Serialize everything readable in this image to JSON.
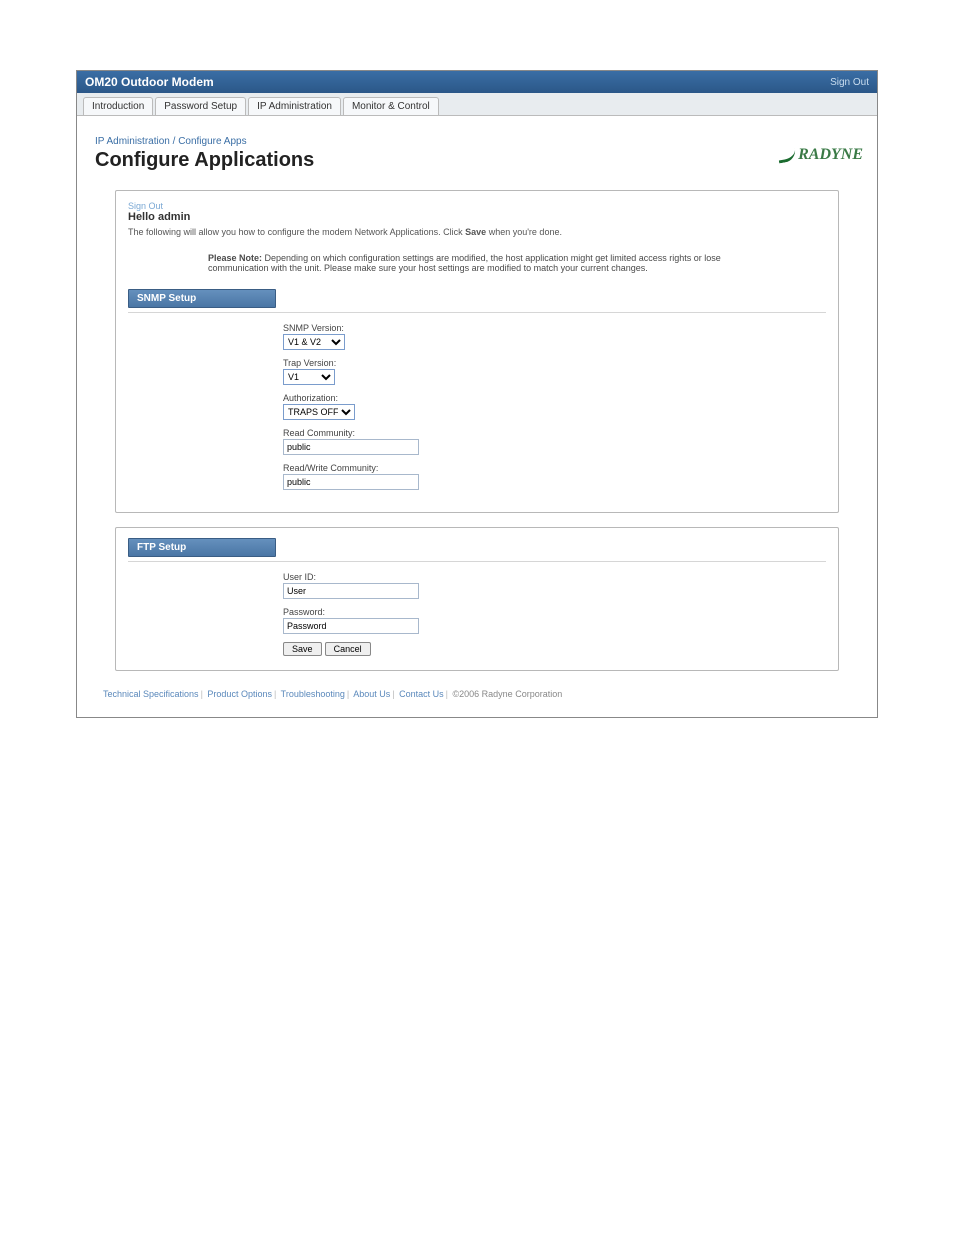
{
  "title_bar": {
    "product": "OM20 Outdoor Modem",
    "signout": "Sign Out"
  },
  "tabs": [
    "Introduction",
    "Password Setup",
    "IP Administration",
    "Monitor & Control"
  ],
  "breadcrumb": "IP Administration / Configure Apps",
  "page_title": "Configure Applications",
  "logo_text": "RADYNE",
  "greeting": {
    "signout": "Sign Out",
    "hello": "Hello admin",
    "desc_pre": "The following will allow you how to configure the modem Network Applications. Click ",
    "desc_bold": "Save",
    "desc_post": " when you're done.",
    "note_bold": "Please Note:",
    "note_rest": " Depending on which configuration settings are modified, the host application might get limited access rights or lose communication with the unit. Please make sure your host settings are modified to match your current changes."
  },
  "snmp": {
    "title": "SNMP Setup",
    "fields": {
      "snmp_version": {
        "label": "SNMP Version:",
        "value": "V1 & V2"
      },
      "trap_version": {
        "label": "Trap Version:",
        "value": "V1"
      },
      "authorization": {
        "label": "Authorization:",
        "value": "TRAPS OFF"
      },
      "read_comm": {
        "label": "Read Community:",
        "value": "public"
      },
      "rw_comm": {
        "label": "Read/Write Community:",
        "value": "public"
      }
    }
  },
  "ftp": {
    "title": "FTP Setup",
    "fields": {
      "user": {
        "label": "User ID:",
        "value": "User"
      },
      "password": {
        "label": "Password:",
        "value": "Password"
      }
    }
  },
  "buttons": {
    "save": "Save",
    "cancel": "Cancel"
  },
  "footer": {
    "links": [
      "Technical Specifications",
      "Product Options",
      "Troubleshooting",
      "About Us",
      "Contact Us"
    ],
    "copyright": "©2006 Radyne Corporation"
  }
}
